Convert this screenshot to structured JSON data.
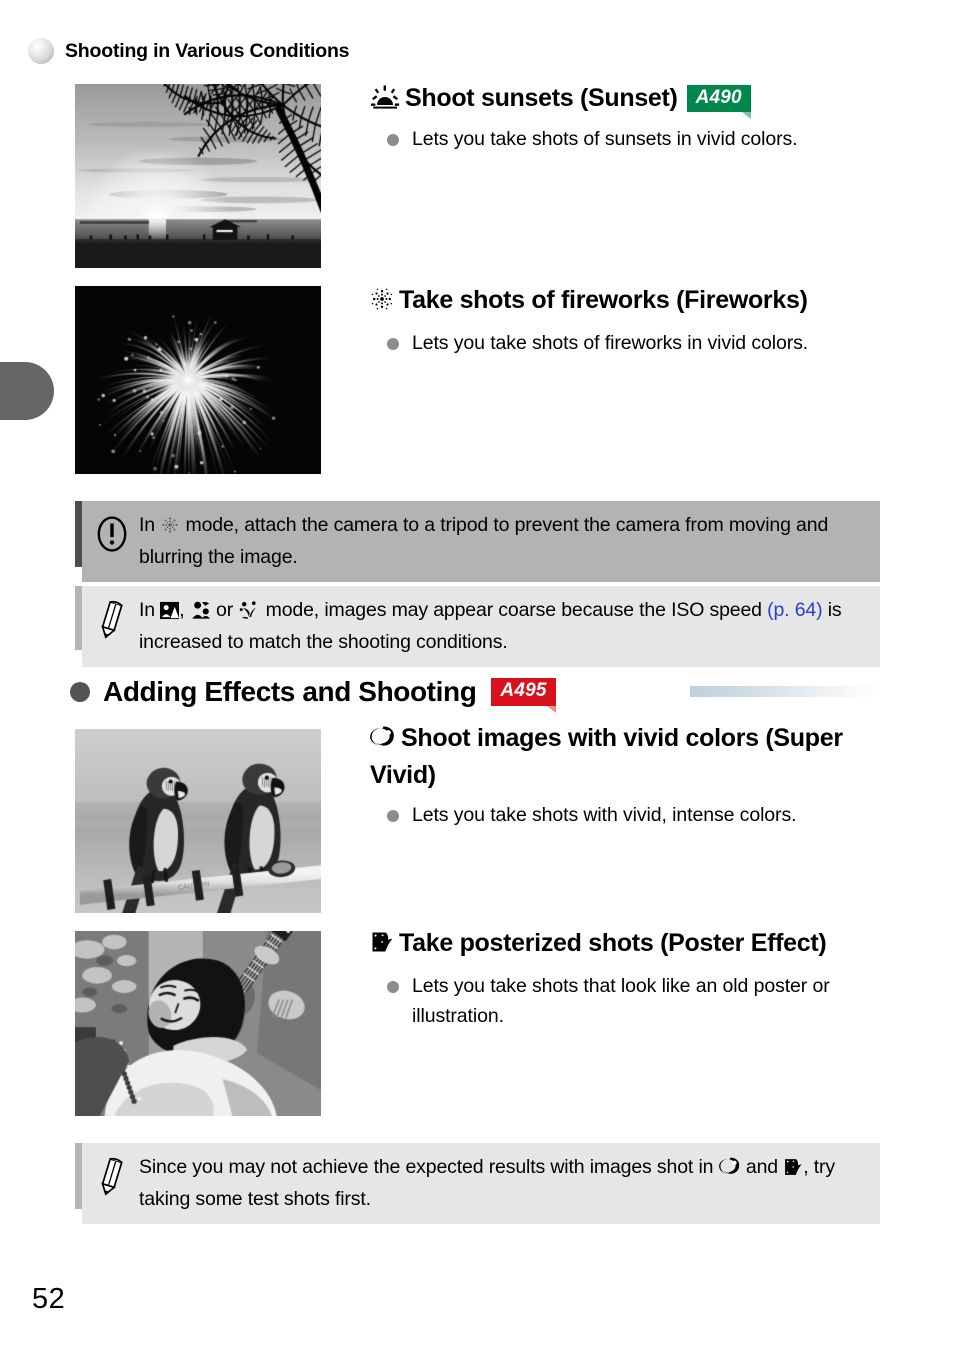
{
  "header": {
    "title": "Shooting in Various Conditions",
    "bullet_icon": "sphere-bullet-icon"
  },
  "sections": [
    {
      "id": "shooting-conditions",
      "entries": [
        {
          "id": "sunset",
          "icon": "sunset-icon",
          "title": "Shoot sunsets (Sunset)",
          "badge": {
            "label": "A490",
            "color": "#00874b"
          },
          "bullets": [
            "Lets you take shots of sunsets in vivid colors."
          ],
          "photo": {
            "name": "sunset-beach-photo",
            "alt": "Sunset over a beach with palm tree silhouette"
          }
        },
        {
          "id": "fireworks",
          "icon": "fireworks-icon",
          "title": "Take shots of fireworks (Fireworks)",
          "badge": null,
          "bullets": [
            "Lets you take shots of fireworks in vivid colors."
          ],
          "photo": {
            "name": "fireworks-burst-photo",
            "alt": "White firework burst against black night sky"
          }
        }
      ],
      "notes": [
        {
          "id": "tripod-caution",
          "kind": "caution",
          "icon": "exclamation-circle-icon",
          "text_before": "In ",
          "inline_icon": "fireworks-icon",
          "text_after": " mode, attach the camera to a tripod to prevent the camera from moving and blurring the image."
        },
        {
          "id": "iso-tip",
          "kind": "tip",
          "icon": "pencil-icon",
          "text_start": "In ",
          "icon_list": [
            "portrait-icon",
            "kids-and-pets-icon",
            "foliage-icon"
          ],
          "separators": [
            ", ",
            " or "
          ],
          "text_middle": " mode, images may appear coarse because the ISO speed ",
          "link": "(p. 64)",
          "text_end": " is increased to match the shooting conditions."
        }
      ]
    },
    {
      "id": "adding-effects",
      "heading": {
        "bullet_icon": "filled-circle-bullet-icon",
        "title": "Adding Effects and Shooting",
        "badge": {
          "label": "A495",
          "color": "#d8121d"
        }
      },
      "entries": [
        {
          "id": "super-vivid",
          "icon": "super-vivid-icon",
          "title": "Shoot images with vivid colors (Super Vivid)",
          "bullets": [
            "Lets you take shots with vivid, intense colors."
          ],
          "photo": {
            "name": "macaw-parrots-photo",
            "alt": "Two macaw parrots perched on a rail"
          }
        },
        {
          "id": "poster-effect",
          "icon": "poster-effect-icon",
          "title": "Take posterized shots (Poster Effect)",
          "bullets": [
            "Lets you take shots that look like an old poster or illustration."
          ],
          "photo": {
            "name": "posterized-portrait-photo",
            "alt": "Posterized photo of a smiling person with a ukulele"
          }
        }
      ],
      "notes": [
        {
          "id": "test-shots-tip",
          "kind": "tip",
          "icon": "pencil-icon",
          "text_start": "Since you may not achieve the expected results with images shot in ",
          "icon_a": "super-vivid-icon",
          "text_middle": " and ",
          "icon_b": "poster-effect-icon",
          "text_end": ", try taking some test shots first."
        }
      ]
    }
  ],
  "folio": {
    "page_number": "52"
  },
  "colors": {
    "badge_green": "#00874b",
    "badge_red": "#d8121d",
    "link_blue": "#2b3ed1",
    "caution_bg": "#b3b3b3",
    "tip_bg": "#e6e6e6",
    "bullet_gray": "#8c8c8c",
    "edge_tab_gray": "#666666"
  }
}
